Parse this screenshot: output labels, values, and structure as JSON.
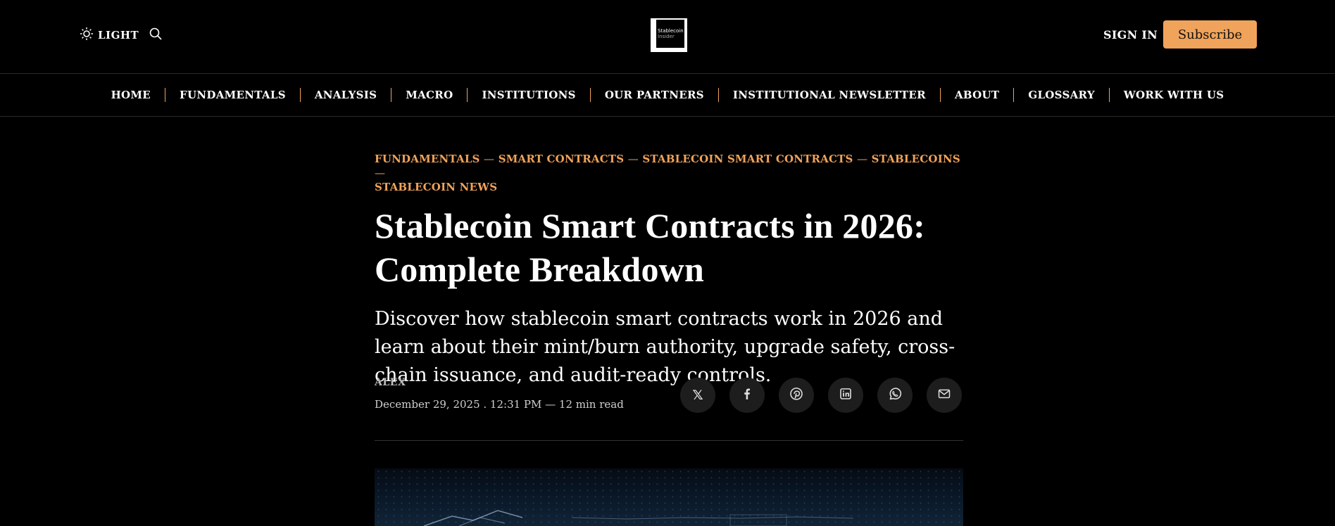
{
  "header": {
    "theme_label": "LIGHT",
    "logo": {
      "line1": "Stablecoin",
      "line2": "Insider"
    },
    "signin_label": "SIGN IN",
    "subscribe_label": "Subscribe",
    "accent_color": "#f0a35a"
  },
  "nav": {
    "items": [
      "HOME",
      "FUNDAMENTALS",
      "ANALYSIS",
      "MACRO",
      "INSTITUTIONS",
      "OUR PARTNERS",
      "INSTITUTIONAL NEWSLETTER",
      "ABOUT",
      "GLOSSARY",
      "WORK WITH US"
    ]
  },
  "article": {
    "categories": [
      "FUNDAMENTALS",
      "SMART CONTRACTS",
      "STABLECOIN SMART CONTRACTS",
      "STABLECOINS",
      "STABLECOIN NEWS"
    ],
    "category_separator": "—",
    "title_line1": "Stablecoin Smart Contracts in 2026:",
    "title_line2": "Complete Breakdown",
    "subtitle": "Discover how stablecoin smart contracts work in 2026 and learn about their mint/burn authority, upgrade safety, cross-chain issuance, and audit-ready controls.",
    "author": "ALEX",
    "dateline": "December 29, 2025 . 12:31 PM — 12 min read"
  },
  "share": {
    "icons": [
      "x-icon",
      "facebook-icon",
      "pinterest-icon",
      "linkedin-icon",
      "whatsapp-icon",
      "email-icon"
    ],
    "x_glyph": "𝕏"
  }
}
